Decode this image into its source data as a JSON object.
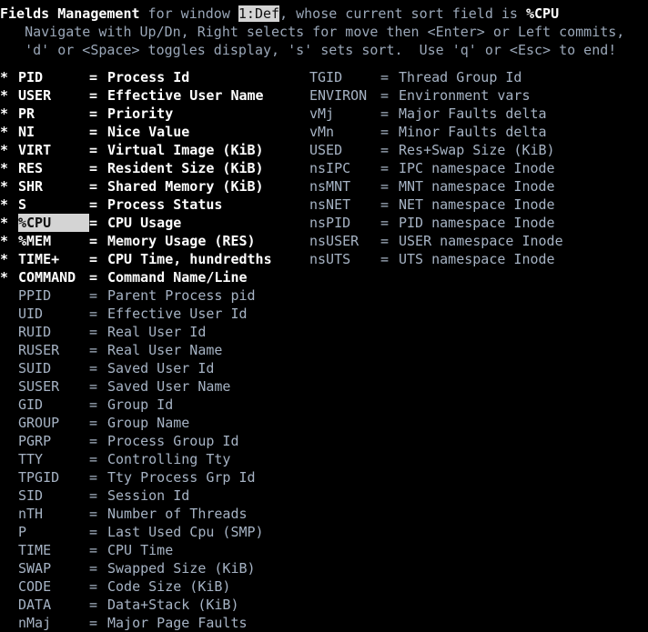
{
  "header": {
    "title": "Fields Management",
    "for_window_label": " for window ",
    "window_name": "1:Def",
    "sort_suffix": ", whose current sort field is ",
    "sort_field": "%CPU",
    "help_line_1": "   Navigate with Up/Dn, Right selects for move then <Enter> or Left commits,",
    "help_line_2": "   'd' or <Space> toggles display, 's' sets sort.  Use 'q' or <Esc> to end!"
  },
  "colors": {
    "background": "#000000",
    "dim_text": "#a6b3c4",
    "bright_text": "#ffffff",
    "highlight_bg": "#d4d4d4",
    "highlight_fg": "#101010"
  },
  "legend": {
    "star_marker": "*",
    "equals": "="
  },
  "columns": {
    "left": [
      {
        "star": "*",
        "enabled": true,
        "selected": false,
        "name": "PID",
        "desc": "Process Id"
      },
      {
        "star": "*",
        "enabled": true,
        "selected": false,
        "name": "USER",
        "desc": "Effective User Name"
      },
      {
        "star": "*",
        "enabled": true,
        "selected": false,
        "name": "PR",
        "desc": "Priority"
      },
      {
        "star": "*",
        "enabled": true,
        "selected": false,
        "name": "NI",
        "desc": "Nice Value"
      },
      {
        "star": "*",
        "enabled": true,
        "selected": false,
        "name": "VIRT",
        "desc": "Virtual Image (KiB)"
      },
      {
        "star": "*",
        "enabled": true,
        "selected": false,
        "name": "RES",
        "desc": "Resident Size (KiB)"
      },
      {
        "star": "*",
        "enabled": true,
        "selected": false,
        "name": "SHR",
        "desc": "Shared Memory (KiB)"
      },
      {
        "star": "*",
        "enabled": true,
        "selected": false,
        "name": "S",
        "desc": "Process Status"
      },
      {
        "star": "*",
        "enabled": true,
        "selected": true,
        "name": "%CPU",
        "desc": "CPU Usage"
      },
      {
        "star": "*",
        "enabled": true,
        "selected": false,
        "name": "%MEM",
        "desc": "Memory Usage (RES)"
      },
      {
        "star": "*",
        "enabled": true,
        "selected": false,
        "name": "TIME+",
        "desc": "CPU Time, hundredths"
      },
      {
        "star": "*",
        "enabled": true,
        "selected": false,
        "name": "COMMAND",
        "desc": "Command Name/Line"
      },
      {
        "star": " ",
        "enabled": false,
        "selected": false,
        "name": "PPID",
        "desc": "Parent Process pid"
      },
      {
        "star": " ",
        "enabled": false,
        "selected": false,
        "name": "UID",
        "desc": "Effective User Id"
      },
      {
        "star": " ",
        "enabled": false,
        "selected": false,
        "name": "RUID",
        "desc": "Real User Id"
      },
      {
        "star": " ",
        "enabled": false,
        "selected": false,
        "name": "RUSER",
        "desc": "Real User Name"
      },
      {
        "star": " ",
        "enabled": false,
        "selected": false,
        "name": "SUID",
        "desc": "Saved User Id"
      },
      {
        "star": " ",
        "enabled": false,
        "selected": false,
        "name": "SUSER",
        "desc": "Saved User Name"
      },
      {
        "star": " ",
        "enabled": false,
        "selected": false,
        "name": "GID",
        "desc": "Group Id"
      },
      {
        "star": " ",
        "enabled": false,
        "selected": false,
        "name": "GROUP",
        "desc": "Group Name"
      },
      {
        "star": " ",
        "enabled": false,
        "selected": false,
        "name": "PGRP",
        "desc": "Process Group Id"
      },
      {
        "star": " ",
        "enabled": false,
        "selected": false,
        "name": "TTY",
        "desc": "Controlling Tty"
      },
      {
        "star": " ",
        "enabled": false,
        "selected": false,
        "name": "TPGID",
        "desc": "Tty Process Grp Id"
      },
      {
        "star": " ",
        "enabled": false,
        "selected": false,
        "name": "SID",
        "desc": "Session Id"
      },
      {
        "star": " ",
        "enabled": false,
        "selected": false,
        "name": "nTH",
        "desc": "Number of Threads"
      },
      {
        "star": " ",
        "enabled": false,
        "selected": false,
        "name": "P",
        "desc": "Last Used Cpu (SMP)"
      },
      {
        "star": " ",
        "enabled": false,
        "selected": false,
        "name": "TIME",
        "desc": "CPU Time"
      },
      {
        "star": " ",
        "enabled": false,
        "selected": false,
        "name": "SWAP",
        "desc": "Swapped Size (KiB)"
      },
      {
        "star": " ",
        "enabled": false,
        "selected": false,
        "name": "CODE",
        "desc": "Code Size (KiB)"
      },
      {
        "star": " ",
        "enabled": false,
        "selected": false,
        "name": "DATA",
        "desc": "Data+Stack (KiB)"
      },
      {
        "star": " ",
        "enabled": false,
        "selected": false,
        "name": "nMaj",
        "desc": "Major Page Faults"
      }
    ],
    "right": [
      {
        "star": " ",
        "enabled": false,
        "selected": false,
        "name": "TGID",
        "desc": "Thread Group Id"
      },
      {
        "star": " ",
        "enabled": false,
        "selected": false,
        "name": "ENVIRON",
        "desc": "Environment vars"
      },
      {
        "star": " ",
        "enabled": false,
        "selected": false,
        "name": "vMj",
        "desc": "Major Faults delta"
      },
      {
        "star": " ",
        "enabled": false,
        "selected": false,
        "name": "vMn",
        "desc": "Minor Faults delta"
      },
      {
        "star": " ",
        "enabled": false,
        "selected": false,
        "name": "USED",
        "desc": "Res+Swap Size (KiB)"
      },
      {
        "star": " ",
        "enabled": false,
        "selected": false,
        "name": "nsIPC",
        "desc": "IPC namespace Inode"
      },
      {
        "star": " ",
        "enabled": false,
        "selected": false,
        "name": "nsMNT",
        "desc": "MNT namespace Inode"
      },
      {
        "star": " ",
        "enabled": false,
        "selected": false,
        "name": "nsNET",
        "desc": "NET namespace Inode"
      },
      {
        "star": " ",
        "enabled": false,
        "selected": false,
        "name": "nsPID",
        "desc": "PID namespace Inode"
      },
      {
        "star": " ",
        "enabled": false,
        "selected": false,
        "name": "nsUSER",
        "desc": "USER namespace Inode"
      },
      {
        "star": " ",
        "enabled": false,
        "selected": false,
        "name": "nsUTS",
        "desc": "UTS namespace Inode"
      }
    ]
  }
}
